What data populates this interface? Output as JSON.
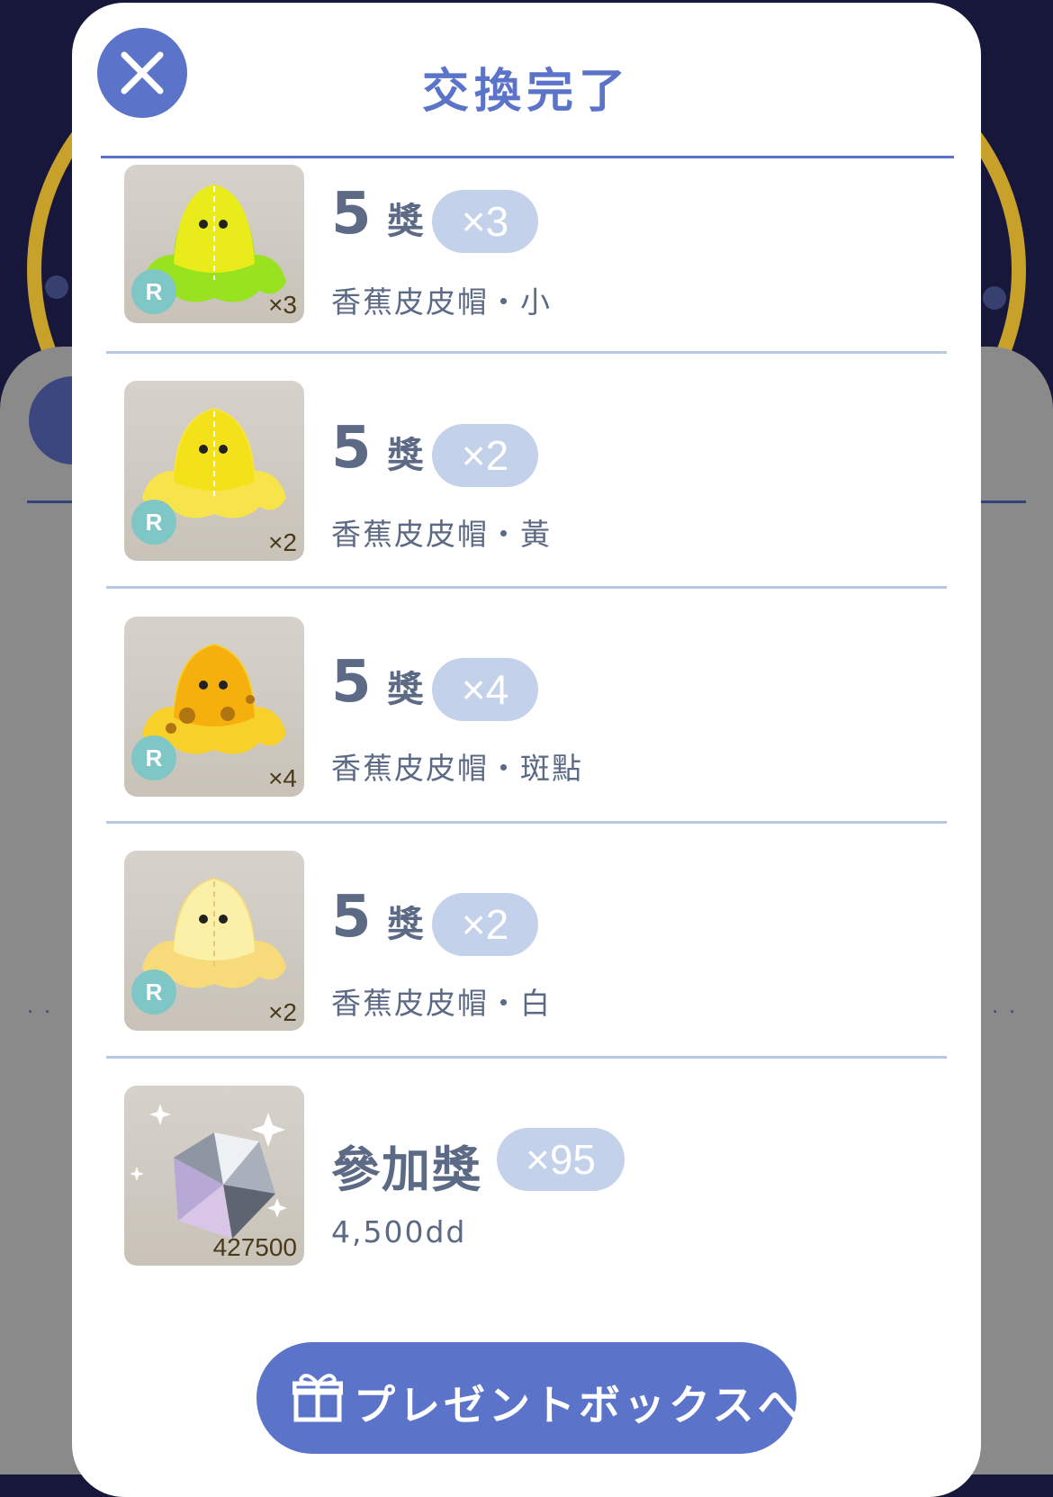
{
  "background": {
    "gold_color": "#c8a12a",
    "navy_color": "#16173a"
  },
  "modal": {
    "title": "交換完了",
    "accent_color": "#5b74c9",
    "close_icon": "close-icon"
  },
  "items": [
    {
      "rank_num": "5",
      "rank_suffix": "獎",
      "count": "×3",
      "name": "香蕉皮皮帽・小",
      "rarity": "R",
      "owned": "×3",
      "hat_color": "#e9ec1a",
      "brim_color": "#98e21f"
    },
    {
      "rank_num": "5",
      "rank_suffix": "獎",
      "count": "×2",
      "name": "香蕉皮皮帽・黃",
      "rarity": "R",
      "owned": "×2",
      "hat_color": "#f3e21a",
      "brim_color": "#f7e34a"
    },
    {
      "rank_num": "5",
      "rank_suffix": "獎",
      "count": "×4",
      "name": "香蕉皮皮帽・斑點",
      "rarity": "R",
      "owned": "×4",
      "hat_color": "#f5b00e",
      "brim_color": "#f8d02a"
    },
    {
      "rank_num": "5",
      "rank_suffix": "獎",
      "count": "×2",
      "name": "香蕉皮皮帽・白",
      "rarity": "R",
      "owned": "×2",
      "hat_color": "#fbf0a8",
      "brim_color": "#f7da7a"
    },
    {
      "rank_full": "參加獎",
      "count": "×95",
      "name": "4,500dd",
      "owned": "427500",
      "icon": "diamond-icon"
    }
  ],
  "present_button": {
    "label": "プレゼントボックスへ",
    "icon": "gift-icon"
  }
}
